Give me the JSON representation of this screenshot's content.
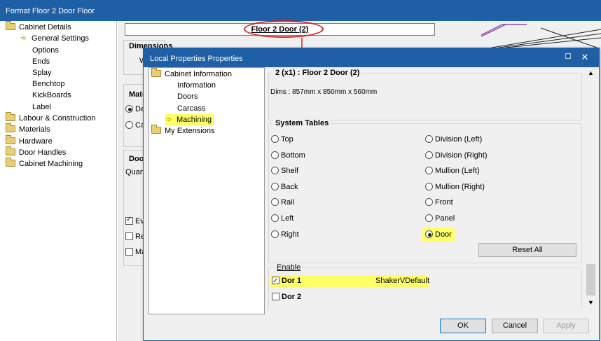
{
  "outer_window": {
    "title": "Format Floor 2 Door Floor",
    "tree": [
      {
        "label": "Cabinet Details",
        "icon": "folder-icon"
      },
      {
        "label": "General Settings",
        "icon": "arrow-icon"
      },
      {
        "label": "Options"
      },
      {
        "label": "Ends"
      },
      {
        "label": "Splay"
      },
      {
        "label": "Benchtop"
      },
      {
        "label": "KickBoards"
      },
      {
        "label": "Label"
      },
      {
        "label": "Labour & Construction",
        "icon": "folder-icon"
      },
      {
        "label": "Materials",
        "icon": "folder-icon"
      },
      {
        "label": "Hardware",
        "icon": "folder-icon"
      },
      {
        "label": "Door Handles",
        "icon": "folder-icon"
      },
      {
        "label": "Cabinet Machining",
        "icon": "folder-icon"
      }
    ],
    "header_title": "Floor 2 Door (2)",
    "partial": {
      "dimensions": "Dimensions",
      "w": "W",
      "mate": "Mate",
      "det": "Det",
      "car": "Car",
      "door": "Door",
      "quant": "Quant",
      "eve": "Eve",
      "rer": "Rer",
      "ma": "Ma"
    }
  },
  "dialog": {
    "title": "Local Properties Properties",
    "max_glyph": "☐",
    "close_glyph": "✕",
    "tree": {
      "root": "Cabinet Information",
      "children": [
        "Information",
        "Doors",
        "Carcass",
        "Machining"
      ],
      "selected": "Machining",
      "extensions": "My Extensions"
    },
    "header": {
      "title": "2 (x1) : Floor 2 Door (2)",
      "dims": "Dims : 857mm x 850mm x 560mm"
    },
    "system_tables": {
      "label": "System Tables",
      "left": [
        "Top",
        "Bottom",
        "Shelf",
        "Back",
        "Rail",
        "Left",
        "Right"
      ],
      "right": [
        "Division (Left)",
        "Division (Right)",
        "Mullion (Left)",
        "Mullion (Right)",
        "Front",
        "Panel",
        "Door"
      ],
      "selected": "Door",
      "reset_label": "Reset All"
    },
    "enable": {
      "label": "Enable",
      "rows": [
        {
          "name": "Dor 1",
          "value": "ShakerVDefault",
          "checked": true
        },
        {
          "name": "Dor 2",
          "value": "",
          "checked": false
        }
      ]
    },
    "buttons": {
      "ok": "OK",
      "cancel": "Cancel",
      "apply": "Apply"
    }
  },
  "colors": {
    "titlebar": "#1f5fa6",
    "highlight": "#ffff66",
    "annotation": "#d42424"
  }
}
